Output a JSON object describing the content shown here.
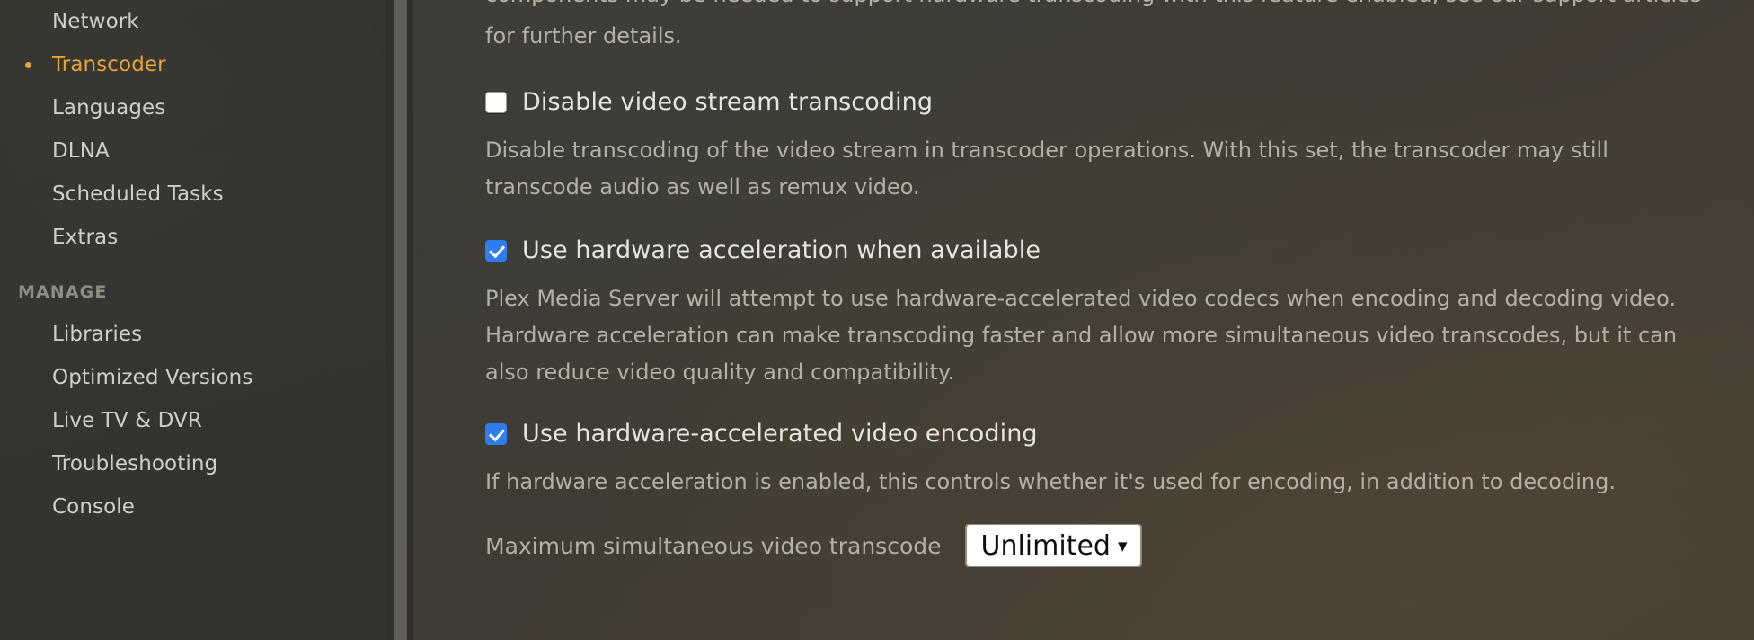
{
  "sidebar": {
    "items": [
      {
        "label": "Network",
        "active": false
      },
      {
        "label": "Transcoder",
        "active": true
      },
      {
        "label": "Languages",
        "active": false
      },
      {
        "label": "DLNA",
        "active": false
      },
      {
        "label": "Scheduled Tasks",
        "active": false
      },
      {
        "label": "Extras",
        "active": false
      }
    ],
    "section_title": "MANAGE",
    "manage_items": [
      {
        "label": "Libraries"
      },
      {
        "label": "Optimized Versions"
      },
      {
        "label": "Live TV & DVR"
      },
      {
        "label": "Troubleshooting"
      },
      {
        "label": "Console"
      }
    ],
    "accent_color": "#e5a33a"
  },
  "main": {
    "intro_clipped_line": "components may be needed to support hardware transcoding with this feature enabled, see our support articles",
    "intro_tail": "for further details.",
    "settings": [
      {
        "id": "disable-video-stream-transcoding",
        "label": "Disable video stream transcoding",
        "checked": false,
        "description": "Disable transcoding of the video stream in transcoder operations. With this set, the transcoder may still transcode audio as well as remux video."
      },
      {
        "id": "use-hardware-acceleration-when-available",
        "label": "Use hardware acceleration when available",
        "checked": true,
        "description": "Plex Media Server will attempt to use hardware-accelerated video codecs when encoding and decoding video. Hardware acceleration can make transcoding faster and allow more simultaneous video transcodes, but it can also reduce video quality and compatibility."
      },
      {
        "id": "use-hardware-accelerated-video-encoding",
        "label": "Use hardware-accelerated video encoding",
        "checked": true,
        "description": "If hardware acceleration is enabled, this controls whether it's used for encoding, in addition to decoding."
      }
    ],
    "max_transcode": {
      "label": "Maximum simultaneous video transcode",
      "value": "Unlimited",
      "chevron": "chevron-down-icon"
    },
    "checkbox_on_color": "#2f7df0"
  }
}
